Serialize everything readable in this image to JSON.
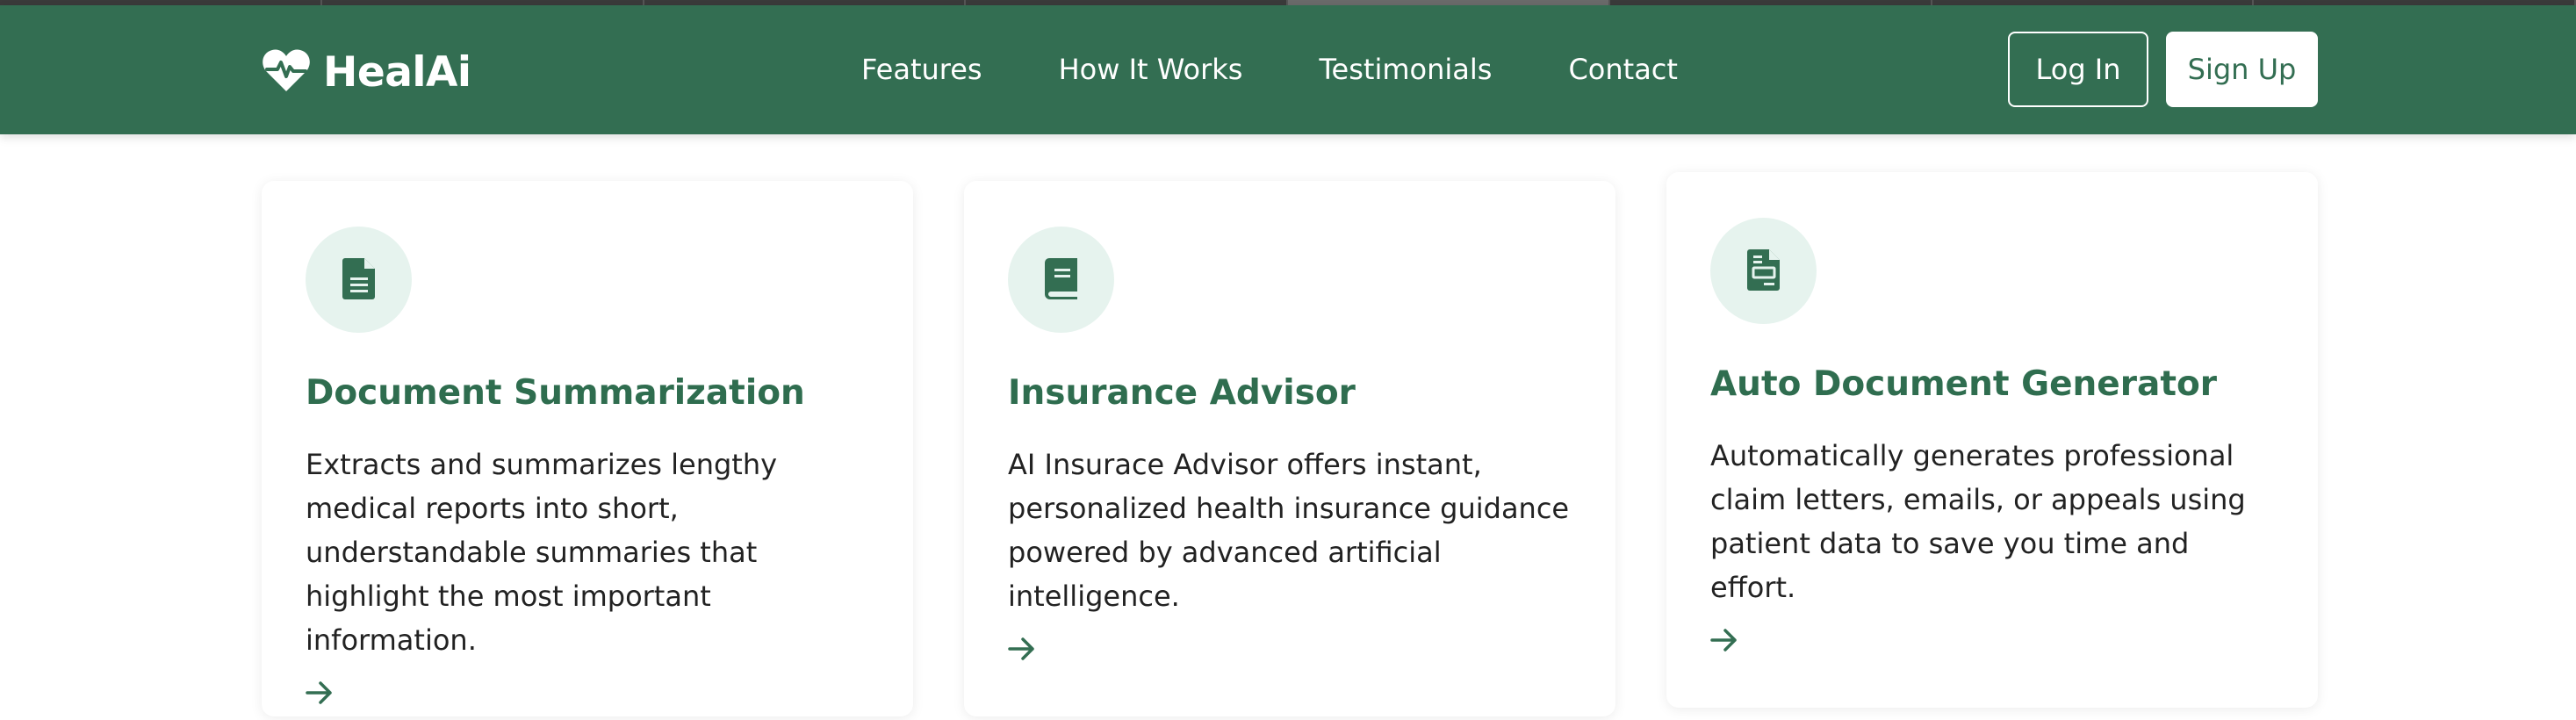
{
  "brand": {
    "name": "HealAi",
    "logo_icon": "heart-pulse-icon"
  },
  "nav": {
    "links": [
      "Features",
      "How It Works",
      "Testimonials",
      "Contact"
    ]
  },
  "auth": {
    "login_label": "Log In",
    "signup_label": "Sign Up"
  },
  "colors": {
    "primary": "#336e52",
    "icon_bg": "#e6f3ee",
    "title": "#2f6d4f",
    "text": "#222222"
  },
  "features": [
    {
      "icon": "document-icon",
      "title": "Document Summarization",
      "description": "Extracts and summarizes lengthy medical reports into short, understandable summaries that highlight the most important information.",
      "arrow_icon": "arrow-right-icon"
    },
    {
      "icon": "book-icon",
      "title": "Insurance Advisor",
      "description": "AI Insurace Advisor offers instant, personalized health insurance guidance powered by advanced artificial intelligence.",
      "arrow_icon": "arrow-right-icon"
    },
    {
      "icon": "file-invoice-icon",
      "title": "Auto Document Generator",
      "description": "Automatically generates professional claim letters, emails, or appeals using patient data to save you time and effort.",
      "arrow_icon": "arrow-right-icon"
    }
  ]
}
